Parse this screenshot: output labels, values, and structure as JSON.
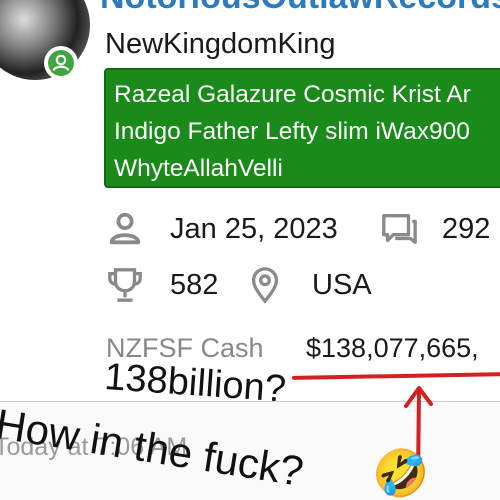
{
  "header": {
    "cut_title": "NotoriousOutlawRecords"
  },
  "profile": {
    "username": "NewKingdomKing",
    "banner_lines": [
      "Razeal Galazure Cosmic Krist Ar",
      "Indigo Father Lefty slim iWax900",
      "WhyteAllahVelli"
    ],
    "joined": "Jan 25, 2023",
    "messages": "292",
    "trophies": "582",
    "location": "USA",
    "cash_label": "NZFSF Cash",
    "cash_value": "$138,077,665,"
  },
  "post": {
    "time": "Today at 7:06 AM"
  },
  "annotations": {
    "line1": "138billion?",
    "line2": "How in the fuck?",
    "emoji": "🤣",
    "accent": "#d32020",
    "banner_color": "#1a8a1a",
    "online_color": "#3fa63f"
  },
  "icons": [
    "person-icon",
    "chat-icon",
    "trophy-icon",
    "location-pin-icon",
    "online-status-icon",
    "arrow-up-icon"
  ]
}
